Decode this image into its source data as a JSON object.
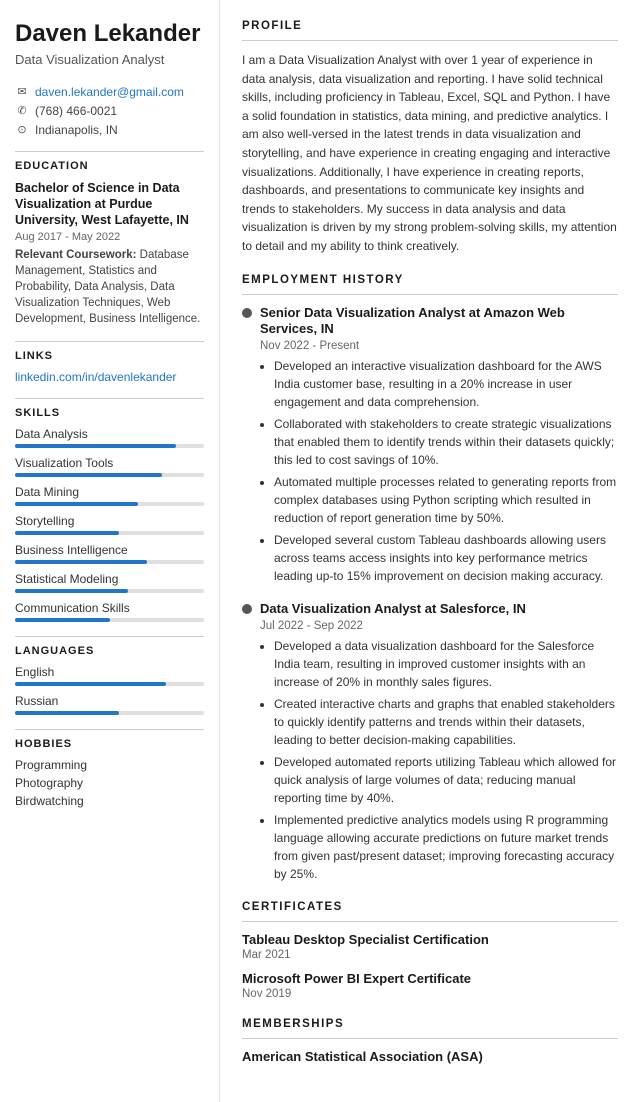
{
  "sidebar": {
    "name": "Daven Lekander",
    "title": "Data Visualization Analyst",
    "contact": {
      "email": "daven.lekander@gmail.com",
      "phone": "(768) 466-0021",
      "location": "Indianapolis, IN"
    },
    "education": {
      "section_title": "Education",
      "degree": "Bachelor of Science in Data Visualization at Purdue University, West Lafayette, IN",
      "dates": "Aug 2017 - May 2022",
      "coursework_label": "Relevant Coursework:",
      "coursework": "Database Management, Statistics and Probability, Data Analysis, Data Visualization Techniques, Web Development, Business Intelligence."
    },
    "links": {
      "section_title": "Links",
      "items": [
        {
          "label": "linkedin.com/in/davenlekander",
          "url": "#"
        }
      ]
    },
    "skills": {
      "section_title": "Skills",
      "items": [
        {
          "label": "Data Analysis",
          "pct": 85
        },
        {
          "label": "Visualization Tools",
          "pct": 78
        },
        {
          "label": "Data Mining",
          "pct": 65
        },
        {
          "label": "Storytelling",
          "pct": 55
        },
        {
          "label": "Business Intelligence",
          "pct": 70
        },
        {
          "label": "Statistical Modeling",
          "pct": 60
        },
        {
          "label": "Communication Skills",
          "pct": 50
        }
      ]
    },
    "languages": {
      "section_title": "Languages",
      "items": [
        {
          "label": "English",
          "pct": 80
        },
        {
          "label": "Russian",
          "pct": 55
        }
      ]
    },
    "hobbies": {
      "section_title": "Hobbies",
      "items": [
        "Programming",
        "Photography",
        "Birdwatching"
      ]
    }
  },
  "main": {
    "profile": {
      "section_title": "Profile",
      "text": "I am a Data Visualization Analyst with over 1 year of experience in data analysis, data visualization and reporting. I have solid technical skills, including proficiency in Tableau, Excel, SQL and Python. I have a solid foundation in statistics, data mining, and predictive analytics. I am also well-versed in the latest trends in data visualization and storytelling, and have experience in creating engaging and interactive visualizations. Additionally, I have experience in creating reports, dashboards, and presentations to communicate key insights and trends to stakeholders. My success in data analysis and data visualization is driven by my strong problem-solving skills, my attention to detail and my ability to think creatively."
    },
    "employment": {
      "section_title": "Employment History",
      "jobs": [
        {
          "title": "Senior Data Visualization Analyst at Amazon Web Services, IN",
          "dates": "Nov 2022 - Present",
          "bullets": [
            "Developed an interactive visualization dashboard for the AWS India customer base, resulting in a 20% increase in user engagement and data comprehension.",
            "Collaborated with stakeholders to create strategic visualizations that enabled them to identify trends within their datasets quickly; this led to cost savings of 10%.",
            "Automated multiple processes related to generating reports from complex databases using Python scripting which resulted in reduction of report generation time by 50%.",
            "Developed several custom Tableau dashboards allowing users across teams access insights into key performance metrics leading up-to 15% improvement on decision making accuracy."
          ]
        },
        {
          "title": "Data Visualization Analyst at Salesforce, IN",
          "dates": "Jul 2022 - Sep 2022",
          "bullets": [
            "Developed a data visualization dashboard for the Salesforce India team, resulting in improved customer insights with an increase of 20% in monthly sales figures.",
            "Created interactive charts and graphs that enabled stakeholders to quickly identify patterns and trends within their datasets, leading to better decision-making capabilities.",
            "Developed automated reports utilizing Tableau which allowed for quick analysis of large volumes of data; reducing manual reporting time by 40%.",
            "Implemented predictive analytics models using R programming language allowing accurate predictions on future market trends from given past/present dataset; improving forecasting accuracy by 25%."
          ]
        }
      ]
    },
    "certificates": {
      "section_title": "Certificates",
      "items": [
        {
          "name": "Tableau Desktop Specialist Certification",
          "date": "Mar 2021"
        },
        {
          "name": "Microsoft Power BI Expert Certificate",
          "date": "Nov 2019"
        }
      ]
    },
    "memberships": {
      "section_title": "Memberships",
      "items": [
        {
          "name": "American Statistical Association (ASA)"
        }
      ]
    }
  }
}
